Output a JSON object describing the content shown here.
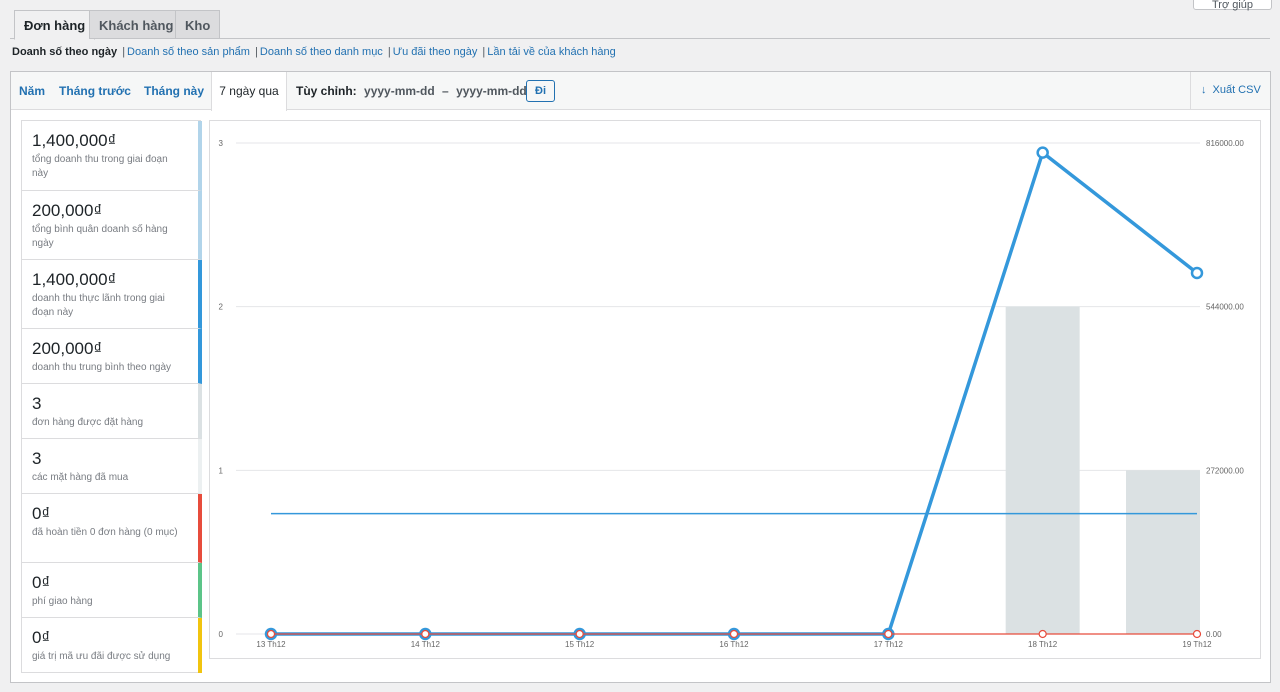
{
  "help_button": "Trợ giúp",
  "tabs": [
    {
      "label": "Đơn hàng"
    },
    {
      "label": "Khách hàng"
    },
    {
      "label": "Kho"
    }
  ],
  "subnav": {
    "current": "Doanh số theo ngày",
    "links": [
      "Doanh số theo sản phẩm",
      "Doanh số theo danh mục",
      "Ưu đãi theo ngày",
      "Lần tải về của khách hàng"
    ],
    "separator": "|"
  },
  "ranges": [
    "Năm",
    "Tháng trước",
    "Tháng này",
    "7 ngày qua"
  ],
  "custom": {
    "label": "Tùy chỉnh:",
    "from_placeholder": "yyyy-mm-dd",
    "dash": "–",
    "to_placeholder": "yyyy-mm-dd",
    "go": "Đi"
  },
  "export_label": "Xuất CSV",
  "legend": [
    {
      "amount": "1,400,000₫",
      "label": "tổng doanh thu trong giai đoạn này",
      "color": "#b1d4ea"
    },
    {
      "amount": "200,000₫",
      "label": "tổng bình quân doanh số hàng ngày",
      "color": "#b1d4ea"
    },
    {
      "amount": "1,400,000₫",
      "label": "doanh thu thực lãnh trong giai đoạn này",
      "color": "#3498db"
    },
    {
      "amount": "200,000₫",
      "label": "doanh thu trung bình theo ngày",
      "color": "#3498db"
    },
    {
      "amount": "3",
      "label": "đơn hàng được đặt hàng",
      "color": "#dbe1e3"
    },
    {
      "amount": "3",
      "label": "các mặt hàng đã mua",
      "color": "#ecf0f1"
    },
    {
      "amount": "0₫",
      "label": "đã hoàn tiền 0 đơn hàng (0 mục)",
      "color": "#e74c3c"
    },
    {
      "amount": "0₫",
      "label": "phí giao hàng",
      "color": "#5cc488"
    },
    {
      "amount": "0₫",
      "label": "giá trị mã ưu đãi được sử dụng",
      "color": "#f1c40f"
    }
  ],
  "chart_data": {
    "type": "line",
    "categories": [
      "13 Th12",
      "14 Th12",
      "15 Th12",
      "16 Th12",
      "17 Th12",
      "18 Th12",
      "19 Th12"
    ],
    "y_left_ticks": [
      "0",
      "1",
      "2",
      "3"
    ],
    "y_left_range": [
      0,
      3
    ],
    "y_right_ticks": [
      "0.00",
      "272000.00",
      "544000.00",
      "816000.00"
    ],
    "y_right_range": [
      0,
      816000
    ],
    "grid": true,
    "series": [
      {
        "kind": "bar",
        "axis": "left",
        "values": [
          0,
          0,
          0,
          0,
          0,
          2,
          1
        ],
        "color": "#dbe1e3"
      },
      {
        "kind": "line",
        "axis": "right",
        "values": [
          0,
          0,
          0,
          0,
          0,
          800000,
          600000
        ],
        "color": "#3498db",
        "markers": true
      },
      {
        "kind": "line",
        "axis": "right",
        "values": [
          200000,
          200000,
          200000,
          200000,
          200000,
          200000,
          200000
        ],
        "color": "#3498db",
        "markers": false
      },
      {
        "kind": "line",
        "axis": "right",
        "values": [
          0,
          0,
          0,
          0,
          0,
          0,
          0
        ],
        "color": "#e74c3c",
        "markers": true
      }
    ]
  }
}
